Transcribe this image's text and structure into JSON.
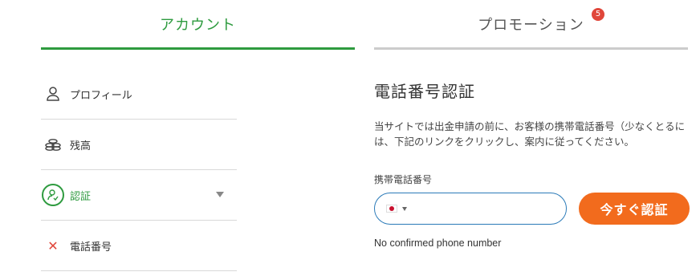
{
  "tabs": {
    "account": "アカウント",
    "promotion": "プロモーション",
    "promotion_badge": "5"
  },
  "menu": {
    "profile": "プロフィール",
    "balance": "残高",
    "verification": "認証",
    "phone": "電話番号"
  },
  "content": {
    "title": "電話番号認証",
    "description": "当サイトでは出金申請の前に、お客様の携帯電話番号（少なくとるには、下記のリンクをクリックし、案内に従ってください。",
    "field_label": "携帯電話番号",
    "phone_value": "",
    "verify_button": "今すぐ認証",
    "status": "No confirmed phone number"
  },
  "colors": {
    "accent_green": "#2e9b3f",
    "button_orange": "#f26b1d",
    "badge_red": "#e0463a",
    "input_border": "#2a7ab8"
  }
}
